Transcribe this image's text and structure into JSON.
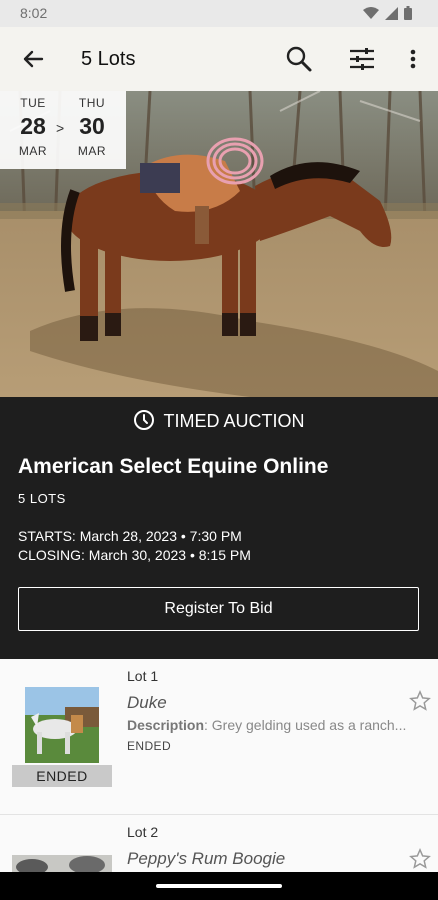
{
  "status_bar": {
    "time": "8:02"
  },
  "app_bar": {
    "title": "5 Lots"
  },
  "dates": {
    "start": {
      "dow": "TUE",
      "day": "28",
      "month": "MAR"
    },
    "separator": ">",
    "end": {
      "dow": "THU",
      "day": "30",
      "month": "MAR"
    }
  },
  "auction": {
    "type_label": "TIMED AUCTION",
    "title": "American Select Equine Online",
    "lot_count": "5 LOTS",
    "starts": "STARTS: March 28, 2023 • 7:30 PM",
    "closing": "CLOSING: March 30, 2023 • 8:15 PM",
    "register_label": "Register To Bid"
  },
  "lots": [
    {
      "lot_no": "Lot 1",
      "name": "Duke",
      "desc_label": "Description",
      "desc_text": ": Grey gelding used as a ranch...",
      "status": "ENDED",
      "badge": "ENDED"
    },
    {
      "lot_no": "Lot 2",
      "name": "Peppy's Rum Boogie"
    }
  ],
  "colors": {
    "info_bg": "#1e1e1e",
    "app_bar_bg": "#f4f3ef",
    "horse": "#7a3a1c",
    "rope": "#e8a0b0"
  }
}
